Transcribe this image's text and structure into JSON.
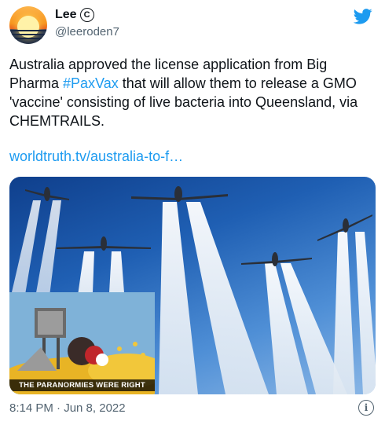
{
  "user": {
    "display_name": "Lee",
    "badge_icon": "copyright-icon",
    "badge_glyph": "C",
    "handle": "@leeroden7"
  },
  "brand": {
    "icon": "twitter-bird-icon",
    "color": "#1d9bf0"
  },
  "tweet": {
    "text_before": "Australia approved the license application from Big Pharma ",
    "hashtag": "#PaxVax",
    "text_after": " that will allow them to release a GMO 'vaccine' consisting of live bacteria into Queensland, via CHEMTRAILS.",
    "link": "worldtruth.tv/australia-to-f…",
    "timestamp": "8:14 PM · Jun 8, 2022"
  },
  "media": {
    "description_icon": "airplanes-contrails-photo",
    "inset_caption": "THE PARANORMIES WERE RIGHT"
  },
  "footer": {
    "info_icon": "info-icon",
    "info_glyph": "i"
  }
}
